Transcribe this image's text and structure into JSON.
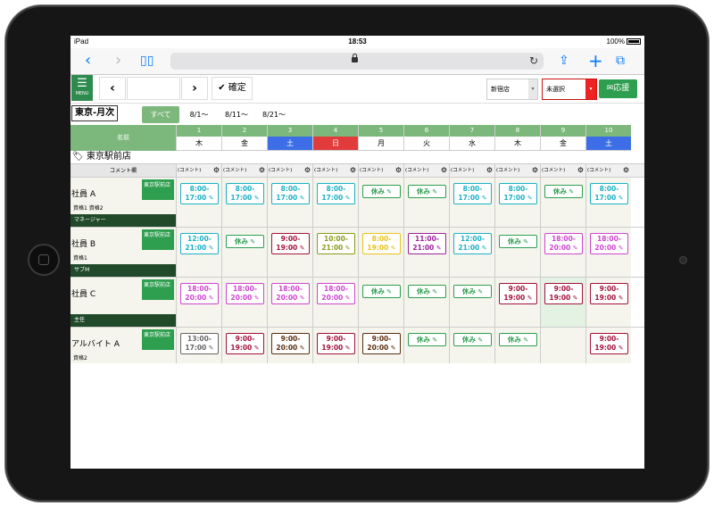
{
  "status_bar": {
    "device": "iPad",
    "time": "18:53",
    "battery": "100%"
  },
  "toolbar": {
    "menu_label": "MENU",
    "confirm_label": "確定",
    "store_select": "新宿店",
    "unselected": "未選択",
    "support_label": "応援"
  },
  "header": {
    "title": "東京-月次"
  },
  "filter_tabs": [
    "すべて",
    "8/1〜",
    "8/11〜",
    "8/21〜"
  ],
  "grid": {
    "name_header": "名前",
    "store_name": "東京駅前店",
    "comment_label": "コメント欄",
    "comment_cell": "(コメント)",
    "days": [
      {
        "num": "1",
        "dow": "木",
        "type": "weekday"
      },
      {
        "num": "2",
        "dow": "金",
        "type": "weekday"
      },
      {
        "num": "3",
        "dow": "土",
        "type": "sat"
      },
      {
        "num": "4",
        "dow": "日",
        "type": "sun"
      },
      {
        "num": "5",
        "dow": "月",
        "type": "weekday"
      },
      {
        "num": "6",
        "dow": "火",
        "type": "weekday"
      },
      {
        "num": "7",
        "dow": "水",
        "type": "weekday"
      },
      {
        "num": "8",
        "dow": "木",
        "type": "weekday"
      },
      {
        "num": "9",
        "dow": "金",
        "type": "weekday"
      },
      {
        "num": "10",
        "dow": "土",
        "type": "sat"
      }
    ],
    "employees": [
      {
        "name": "社員 A",
        "quals": "資格1 資格2",
        "store": "東京駅前店",
        "role": "マネージャー",
        "shifts": [
          {
            "t": "8:00-\n17:00",
            "c": "#1bb0c4"
          },
          {
            "t": "8:00-\n17:00",
            "c": "#1bb0c4"
          },
          {
            "t": "8:00-\n17:00",
            "c": "#1bb0c4"
          },
          {
            "t": "8:00-\n17:00",
            "c": "#1bb0c4"
          },
          {
            "t": "休み",
            "c": "#2e9e4f",
            "off": true
          },
          {
            "t": "休み",
            "c": "#2e9e4f",
            "off": true
          },
          {
            "t": "8:00-\n17:00",
            "c": "#1bb0c4"
          },
          {
            "t": "8:00-\n17:00",
            "c": "#1bb0c4"
          },
          {
            "t": "休み",
            "c": "#2e9e4f",
            "off": true
          },
          {
            "t": "8:00-\n17:00",
            "c": "#1bb0c4"
          }
        ]
      },
      {
        "name": "社員 B",
        "quals": "資格1",
        "store": "東京駅前店",
        "role": "サブM",
        "shifts": [
          {
            "t": "12:00-\n21:00",
            "c": "#1bb0c4"
          },
          {
            "t": "休み",
            "c": "#2e9e4f",
            "off": true
          },
          {
            "t": "9:00-\n19:00",
            "c": "#a3123a"
          },
          {
            "t": "10:00-\n21:00",
            "c": "#8a9a1a"
          },
          {
            "t": "8:00-\n19:00",
            "c": "#e8c21a"
          },
          {
            "t": "11:00-\n21:00",
            "c": "#9c1f9c"
          },
          {
            "t": "12:00-\n21:00",
            "c": "#1bb0c4"
          },
          {
            "t": "休み",
            "c": "#2e9e4f",
            "off": true
          },
          {
            "t": "18:00-\n20:00",
            "c": "#cf44cf"
          },
          {
            "t": "18:00-\n20:00",
            "c": "#cf44cf"
          }
        ]
      },
      {
        "name": "社員 C",
        "quals": "",
        "store": "東京駅前店",
        "role": "主任",
        "shifts": [
          {
            "t": "18:00-\n20:00",
            "c": "#cf44cf"
          },
          {
            "t": "18:00-\n20:00",
            "c": "#cf44cf"
          },
          {
            "t": "18:00-\n20:00",
            "c": "#cf44cf"
          },
          {
            "t": "18:00-\n20:00",
            "c": "#cf44cf"
          },
          {
            "t": "休み",
            "c": "#2e9e4f",
            "off": true
          },
          {
            "t": "休み",
            "c": "#2e9e4f",
            "off": true
          },
          {
            "t": "休み",
            "c": "#2e9e4f",
            "off": true
          },
          {
            "t": "9:00-\n19:00",
            "c": "#a3123a"
          },
          {
            "t": "9:00-\n19:00",
            "c": "#a3123a",
            "hl": true
          },
          {
            "t": "9:00-\n19:00",
            "c": "#a3123a"
          }
        ]
      },
      {
        "name": "アルバイト A",
        "quals": "資格2",
        "store": "東京駅前店",
        "role": "",
        "shifts": [
          {
            "t": "13:00-\n17:00",
            "c": "#666666"
          },
          {
            "t": "9:00-\n19:00",
            "c": "#a3123a"
          },
          {
            "t": "9:00-\n20:00",
            "c": "#5a3010"
          },
          {
            "t": "9:00-\n19:00",
            "c": "#a3123a"
          },
          {
            "t": "9:00-\n20:00",
            "c": "#5a3010"
          },
          {
            "t": "休み",
            "c": "#2e9e4f",
            "off": true
          },
          {
            "t": "休み",
            "c": "#2e9e4f",
            "off": true
          },
          {
            "t": "休み",
            "c": "#2e9e4f",
            "off": true
          },
          {
            "t": "",
            "c": "#cccccc",
            "empty": true
          },
          {
            "t": "9:00-\n19:00",
            "c": "#a3123a"
          }
        ]
      }
    ]
  }
}
